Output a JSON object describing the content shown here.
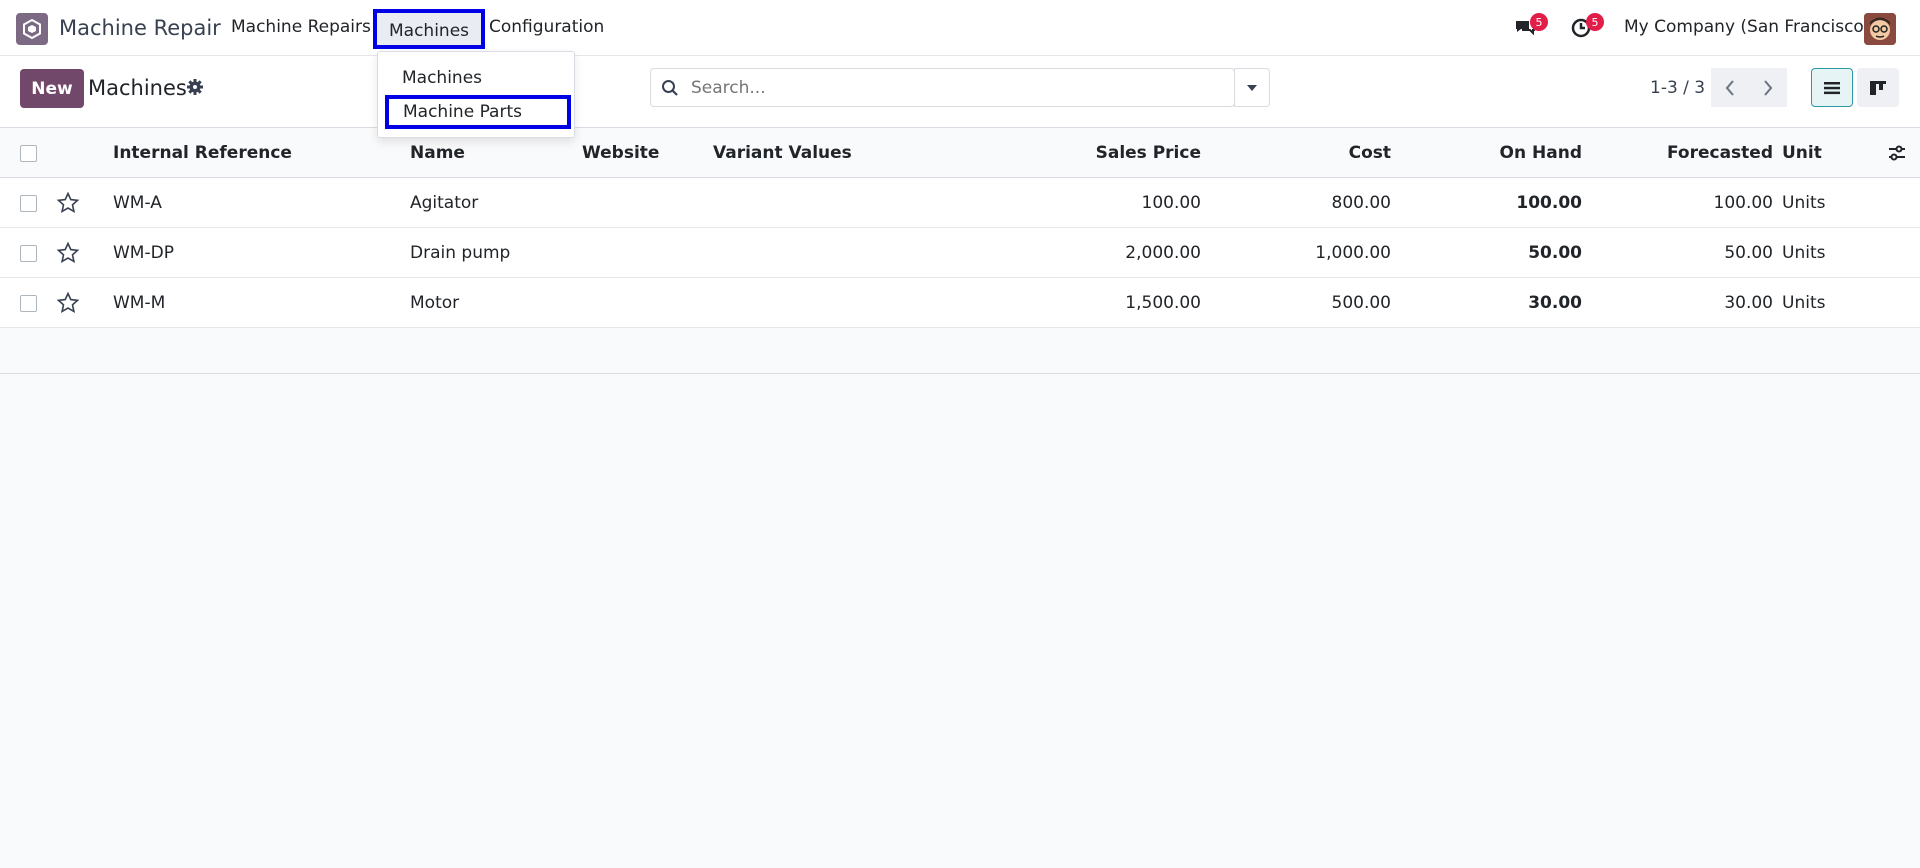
{
  "app": {
    "name": "Machine Repair"
  },
  "nav": {
    "items": [
      {
        "label": "Machine Repairs"
      },
      {
        "label": "Machines"
      },
      {
        "label": "Configuration"
      }
    ],
    "messages_badge": "5",
    "activities_badge": "5",
    "company": "My Company (San Francisco)"
  },
  "dropdown": {
    "items": [
      {
        "label": "Machines"
      },
      {
        "label": "Machine Parts"
      }
    ]
  },
  "control": {
    "new_label": "New",
    "title": "Machines",
    "search_placeholder": "Search...",
    "pager": "1-3 / 3"
  },
  "table": {
    "columns": [
      "Internal Reference",
      "Name",
      "Website",
      "Variant Values",
      "Sales Price",
      "Cost",
      "On Hand",
      "Forecasted",
      "Unit"
    ],
    "rows": [
      {
        "ref": "WM-A",
        "name": "Agitator",
        "website": "",
        "variant": "",
        "sales_price": "100.00",
        "cost": "800.00",
        "on_hand": "100.00",
        "forecasted": "100.00",
        "unit": "Units"
      },
      {
        "ref": "WM-DP",
        "name": "Drain pump",
        "website": "",
        "variant": "",
        "sales_price": "2,000.00",
        "cost": "1,000.00",
        "on_hand": "50.00",
        "forecasted": "50.00",
        "unit": "Units"
      },
      {
        "ref": "WM-M",
        "name": "Motor",
        "website": "",
        "variant": "",
        "sales_price": "1,500.00",
        "cost": "500.00",
        "on_hand": "30.00",
        "forecasted": "30.00",
        "unit": "Units"
      }
    ]
  },
  "colors": {
    "brand": "#71476a",
    "highlight": "#0000e6",
    "badge": "#e11d48"
  },
  "icons": [
    "app-logo-icon",
    "chat-icon",
    "clock-icon",
    "gear-icon",
    "search-icon",
    "caret-down-icon",
    "chevron-left-icon",
    "chevron-right-icon",
    "list-view-icon",
    "kanban-view-icon",
    "star-icon",
    "column-settings-icon"
  ]
}
